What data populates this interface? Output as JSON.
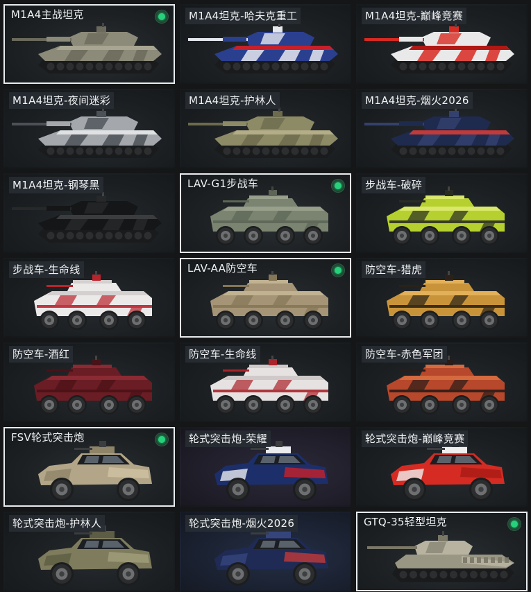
{
  "vehicles": [
    {
      "name": "M1A4主战坦克",
      "type": "tank",
      "selected": true,
      "equipped": true,
      "colors": [
        "#8c8a78",
        "#6b6a5c",
        "#a8a692"
      ]
    },
    {
      "name": "M1A4坦克-哈夫克重工",
      "type": "tank",
      "selected": false,
      "equipped": false,
      "colors": [
        "#2b3f8f",
        "#e6e8ef",
        "#c8202a"
      ]
    },
    {
      "name": "M1A4坦克-巅峰竞赛",
      "type": "tank",
      "selected": false,
      "equipped": false,
      "colors": [
        "#e9e9e9",
        "#d82a22",
        "#b01814"
      ]
    },
    {
      "name": "M1A4坦克-夜间迷彩",
      "type": "tank",
      "selected": false,
      "equipped": false,
      "colors": [
        "#a4a8ad",
        "#4c5157",
        "#dfe1e3"
      ]
    },
    {
      "name": "M1A4坦克-护林人",
      "type": "tank",
      "selected": false,
      "equipped": false,
      "colors": [
        "#8d8a66",
        "#6d6b4d",
        "#b3ad88"
      ]
    },
    {
      "name": "M1A4坦克-烟火2026",
      "type": "tank",
      "selected": false,
      "equipped": false,
      "colors": [
        "#1f2a4f",
        "#34416e",
        "#c23a3a"
      ]
    },
    {
      "name": "M1A4坦克-钢琴黑",
      "type": "tank",
      "selected": false,
      "equipped": false,
      "colors": [
        "#151617",
        "#262829",
        "#3a3c3e"
      ]
    },
    {
      "name": "LAV-G1步战车",
      "type": "wheeled",
      "selected": true,
      "equipped": true,
      "colors": [
        "#7a8470",
        "#5d6656",
        "#98a08c"
      ]
    },
    {
      "name": "步战车-破碎",
      "type": "wheeled",
      "selected": false,
      "equipped": false,
      "colors": [
        "#b6d12f",
        "#2a2d22",
        "#d9e86a"
      ]
    },
    {
      "name": "步战车-生命线",
      "type": "wheeled",
      "selected": false,
      "equipped": false,
      "colors": [
        "#ece9e9",
        "#b9242c",
        "#d5d0d0"
      ]
    },
    {
      "name": "LAV-AA防空车",
      "type": "wheeled",
      "selected": true,
      "equipped": true,
      "colors": [
        "#a59475",
        "#857657",
        "#c1b291"
      ]
    },
    {
      "name": "防空车-猎虎",
      "type": "wheeled",
      "selected": false,
      "equipped": false,
      "colors": [
        "#c99439",
        "#2a2218",
        "#e3b05a"
      ]
    },
    {
      "name": "防空车-酒红",
      "type": "wheeled",
      "selected": false,
      "equipped": false,
      "colors": [
        "#6a1d24",
        "#4a1217",
        "#8b2a33"
      ]
    },
    {
      "name": "防空车-生命线",
      "type": "wheeled",
      "selected": false,
      "equipped": false,
      "colors": [
        "#e7e2e2",
        "#a9232a",
        "#cfc9c9"
      ]
    },
    {
      "name": "防空车-赤色军团",
      "type": "wheeled",
      "selected": false,
      "equipped": false,
      "colors": [
        "#b8482b",
        "#2a1c18",
        "#d56a3f"
      ]
    },
    {
      "name": "FSV轮式突击炮",
      "type": "buggy",
      "selected": true,
      "equipped": true,
      "colors": [
        "#b3a688",
        "#8f8468",
        "#cfc3a4"
      ]
    },
    {
      "name": "轮式突击炮-荣耀",
      "type": "buggy",
      "selected": false,
      "equipped": false,
      "colors": [
        "#1c2f6b",
        "#e9ebef",
        "#c8202a"
      ]
    },
    {
      "name": "轮式突击炮-巅峰竞赛",
      "type": "buggy",
      "selected": false,
      "equipped": false,
      "colors": [
        "#d52b22",
        "#efefef",
        "#a81b15"
      ]
    },
    {
      "name": "轮式突击炮-护林人",
      "type": "buggy",
      "selected": false,
      "equipped": false,
      "colors": [
        "#7e7c5d",
        "#5d5c44",
        "#a19d7c"
      ]
    },
    {
      "name": "轮式突击炮-烟火2026",
      "type": "buggy",
      "selected": false,
      "equipped": false,
      "colors": [
        "#1f2b55",
        "#35457c",
        "#c33a3a"
      ]
    },
    {
      "name": "GTQ-35轻型坦克",
      "type": "light-tank",
      "selected": true,
      "equipped": true,
      "colors": [
        "#9a9684",
        "#7a7767",
        "#b7b3a0"
      ]
    }
  ],
  "backgrounds": {
    "轮式突击炮-荣耀": "bg-purple",
    "轮式突击炮-烟火2026": "bg-night"
  }
}
